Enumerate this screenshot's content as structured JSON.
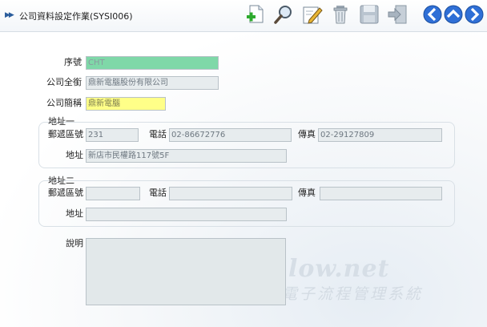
{
  "header": {
    "title": "公司資料設定作業(SYSI006)"
  },
  "toolbar": {
    "icons": [
      "add-icon",
      "search-icon",
      "edit-icon",
      "delete-icon",
      "save-icon",
      "exit-icon"
    ],
    "nav": [
      "prev-icon",
      "up-icon",
      "next-icon"
    ],
    "accent": "#2f6fd6"
  },
  "form": {
    "serial": {
      "label": "序號",
      "value": "CHT"
    },
    "full_name": {
      "label": "公司全銜",
      "value": "鼎新電腦股份有限公司"
    },
    "short_name": {
      "label": "公司簡稱",
      "value": "鼎新電腦"
    },
    "address1": {
      "title": "地址一",
      "zip_label": "郵遞區號",
      "zip_value": "231",
      "phone_label": "電話",
      "phone_value": "02-86672776",
      "fax_label": "傳真",
      "fax_value": "02-29127809",
      "addr_label": "地址",
      "addr_value": "新店市民權路117號5F"
    },
    "address2": {
      "title": "地址二",
      "zip_label": "郵遞區號",
      "zip_value": "",
      "phone_label": "電話",
      "phone_value": "",
      "fax_label": "傳真",
      "fax_value": "",
      "addr_label": "地址",
      "addr_value": ""
    },
    "note": {
      "label": "說明",
      "value": ""
    }
  },
  "watermark": {
    "line1": "low.net",
    "line2": "電子流程管理系統"
  },
  "colors": {
    "serial_bg": "#7fd8a8",
    "short_name_bg": "#ffff88",
    "field_bg": "#e7ecee"
  }
}
